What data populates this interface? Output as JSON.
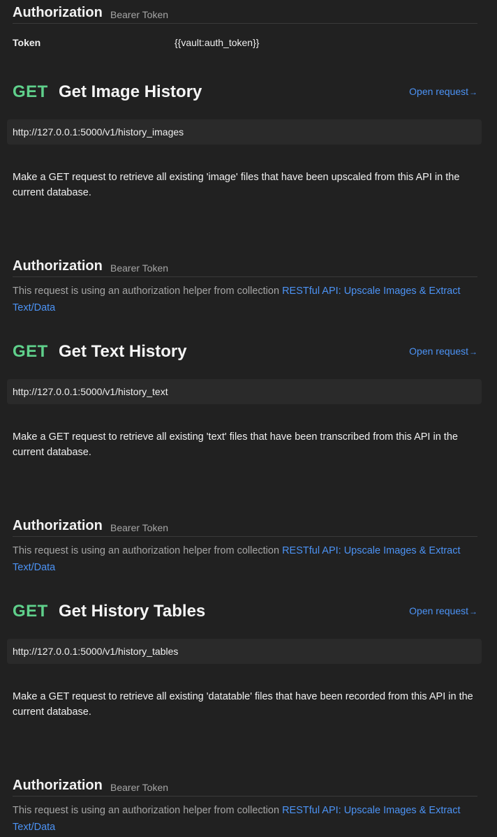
{
  "top_auth": {
    "title": "Authorization",
    "type": "Bearer Token",
    "token_label": "Token",
    "token_value": "{{vault:auth_token}}"
  },
  "open_request_label": "Open request",
  "requests": [
    {
      "method": "GET",
      "name": "Get Image History",
      "url": "http://127.0.0.1:5000/v1/history_images",
      "description": "Make a GET request to retrieve all existing 'image' files that have been upscaled from this API in the current database.",
      "auth_title": "Authorization",
      "auth_type": "Bearer Token",
      "helper_text": "This request is using an authorization helper from collection ",
      "collection_name": "RESTful API: Upscale Images & Extract Text/Data"
    },
    {
      "method": "GET",
      "name": "Get Text History",
      "url": "http://127.0.0.1:5000/v1/history_text",
      "description": "Make a GET request to retrieve all existing 'text' files that have been transcribed from this API in the current database.",
      "auth_title": "Authorization",
      "auth_type": "Bearer Token",
      "helper_text": "This request is using an authorization helper from collection ",
      "collection_name": "RESTful API: Upscale Images & Extract Text/Data"
    },
    {
      "method": "GET",
      "name": "Get History Tables",
      "url": "http://127.0.0.1:5000/v1/history_tables",
      "description": "Make a GET request to retrieve all existing 'datatable' files that have been recorded from this API in the current database.",
      "auth_title": "Authorization",
      "auth_type": "Bearer Token",
      "helper_text": "This request is using an authorization helper from collection ",
      "collection_name": "RESTful API: Upscale Images & Extract Text/Data"
    }
  ],
  "icons": {
    "open_request_arrow": "arrow-right-icon"
  },
  "colors": {
    "background": "#212121",
    "method_get": "#5fd08b",
    "link": "#4c93f5",
    "url_box": "#2a2a2a",
    "muted_text": "#a6a6a6"
  }
}
